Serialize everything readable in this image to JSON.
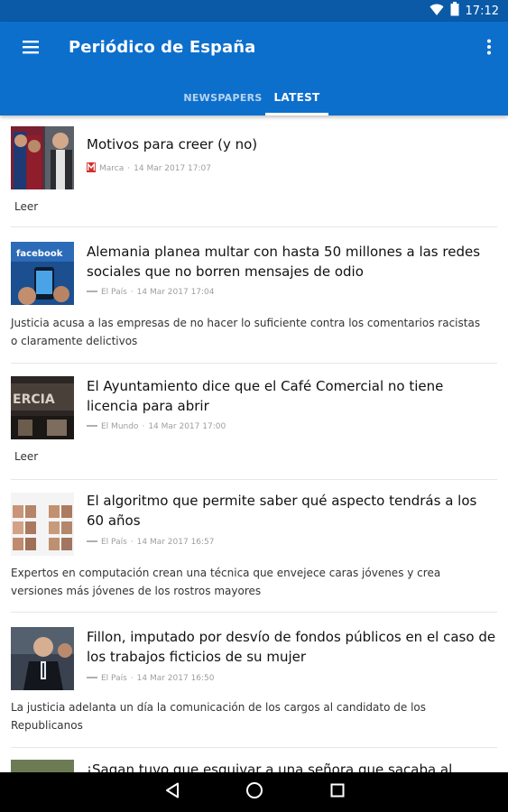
{
  "status_bar": {
    "time": "17:12"
  },
  "app_bar": {
    "title": "Periódico de España"
  },
  "tabs": [
    {
      "label": "NEWSPAPERS",
      "selected": false
    },
    {
      "label": "LATEST",
      "selected": true
    }
  ],
  "articles": [
    {
      "headline": "Motivos para creer (y no)",
      "source": "Marca",
      "date": "14 Mar 2017 17:07",
      "summary": "Leer",
      "thumbnail": "football-players-photo"
    },
    {
      "headline": "Alemania planea multar con hasta 50 millones a las redes sociales que no borren mensajes de odio",
      "source": "El País",
      "date": "14 Mar 2017 17:04",
      "summary": "Justicia acusa a las empresas de no hacer lo suficiente contra los comentarios racistas o claramente delictivos",
      "thumbnail": "facebook-phone-photo"
    },
    {
      "headline": "El Ayuntamiento dice que el Café Comercial no tiene licencia para abrir",
      "source": "El Mundo",
      "date": "14 Mar 2017 17:00",
      "summary": "Leer",
      "thumbnail": "cafe-sign-photo"
    },
    {
      "headline": "El algoritmo que permite saber qué aspecto tendrás a los 60 años",
      "source": "El País",
      "date": "14 Mar 2017 16:57",
      "summary": "Expertos en computación crean una técnica que envejece caras jóvenes y crea versiones más jóvenes de los rostros mayores",
      "thumbnail": "faces-grid-photo"
    },
    {
      "headline": "Fillon, imputado por desvío de fondos públicos en el caso de los trabajos ficticios de su mujer",
      "source": "El País",
      "date": "14 Mar 2017 16:50",
      "summary": "La justicia adelanta un día la comunicación de los cargos al candidato de los Republicanos",
      "thumbnail": "politician-photo"
    },
    {
      "headline": "¡Sagan tuvo que esquivar a una señora que sacaba al",
      "thumbnail": "cycling-photo"
    }
  ],
  "icons": {
    "menu": "hamburger-menu-icon",
    "overflow": "more-vert-icon",
    "wifi": "wifi-icon",
    "battery": "battery-icon",
    "back": "nav-back-icon",
    "home": "nav-home-icon",
    "recents": "nav-recents-icon"
  },
  "colors": {
    "app_bar": "#0d6fcc",
    "status_bar": "#0a5aa8",
    "marca_red": "#d32f2f"
  }
}
